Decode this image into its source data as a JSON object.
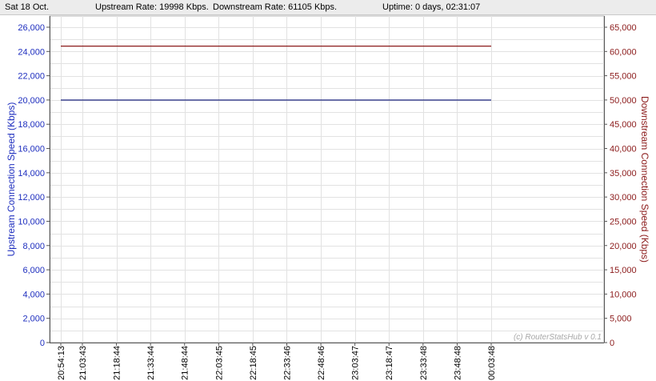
{
  "status": {
    "date": "Sat 18 Oct.",
    "upstream": "Upstream Rate: 19998 Kbps.",
    "downstream": "Downstream Rate: 61105 Kbps.",
    "uptime": "Uptime: 0 days, 02:31:07"
  },
  "watermark": "(c) RouterStatsHub v 0.1",
  "colors": {
    "upstream": "#1a237e",
    "downstream": "#8b1a1a",
    "grid": "#e2e2e2",
    "left_axis_text": "#1f2fbf",
    "right_axis_text": "#8b1a1a"
  },
  "chart_data": {
    "type": "line",
    "x": [
      "20:54:13",
      "21:03:43",
      "21:18:44",
      "21:33:44",
      "21:48:44",
      "22:03:45",
      "22:18:45",
      "22:33:46",
      "22:48:46",
      "23:03:47",
      "23:18:47",
      "23:33:48",
      "23:48:48",
      "00:03:48"
    ],
    "x_minutes": [
      0,
      9.5,
      24.5,
      39.5,
      54.5,
      69.5,
      84.5,
      99.5,
      114.5,
      129.5,
      144.5,
      159.5,
      174.5,
      189.5
    ],
    "series": [
      {
        "name": "Upstream",
        "axis": "left",
        "values": [
          19998,
          19998,
          19998,
          19998,
          19998,
          19998,
          19998,
          19998,
          19998,
          19998,
          19998,
          19998,
          19998,
          19998
        ]
      },
      {
        "name": "Downstream",
        "axis": "right",
        "values": [
          61105,
          61105,
          61105,
          61105,
          61105,
          61105,
          61105,
          61105,
          61105,
          61105,
          61105,
          61105,
          61105,
          61105
        ]
      }
    ],
    "ylabel_left": "Upstream Connection Speed (Kbps)",
    "ylabel_right": "Downstream Connection Speed (Kbps)",
    "ylim_left": [
      0,
      26000
    ],
    "ylim_right": [
      0,
      65000
    ],
    "yticks_left": [
      "0",
      "2,000",
      "4,000",
      "6,000",
      "8,000",
      "10,000",
      "12,000",
      "14,000",
      "16,000",
      "18,000",
      "20,000",
      "22,000",
      "24,000",
      "26,000"
    ],
    "yticks_right": [
      "0",
      "5,000",
      "10,000",
      "15,000",
      "20,000",
      "25,000",
      "30,000",
      "35,000",
      "40,000",
      "45,000",
      "50,000",
      "55,000",
      "60,000",
      "65,000"
    ],
    "grid": true
  }
}
